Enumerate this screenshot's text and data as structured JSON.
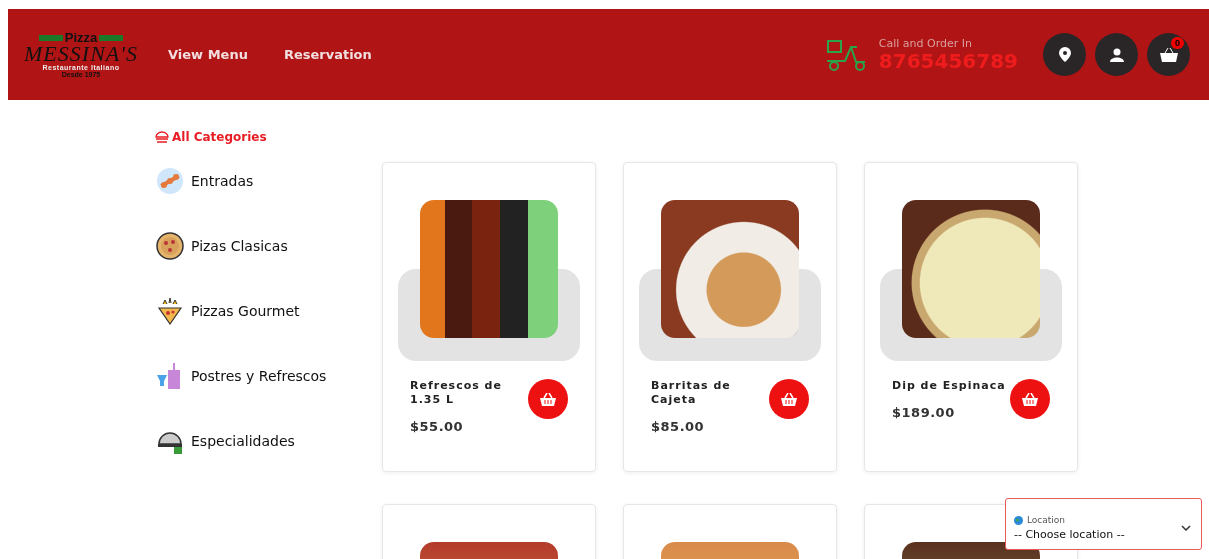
{
  "header": {
    "logo": {
      "top": "Pizza",
      "name": "MESSINA'S",
      "subtitle": "Restaurante Italiano",
      "since": "Desde 1975"
    },
    "nav": [
      {
        "label": "View Menu"
      },
      {
        "label": "Reservation"
      }
    ],
    "call": {
      "label": "Call and Order In",
      "phone": "8765456789"
    },
    "cart_count": "0"
  },
  "sidebar": {
    "title": "All Categories",
    "items": [
      {
        "label": "Entradas",
        "kind": "skewer"
      },
      {
        "label": "Pizas Clasicas",
        "kind": "pizza"
      },
      {
        "label": "Pizzas Gourmet",
        "kind": "slice"
      },
      {
        "label": "Postres y Refrescos",
        "kind": "drink"
      },
      {
        "label": "Especialidades",
        "kind": "cloche"
      }
    ]
  },
  "products": [
    {
      "kind": "full",
      "name": "Refrescos de 1.35 L",
      "price": "$55.00"
    },
    {
      "kind": "full",
      "name": "Barritas de Cajeta",
      "price": "$85.00"
    },
    {
      "kind": "full",
      "name": "Dip de Espinaca",
      "price": "$189.00"
    },
    {
      "kind": "cut_off"
    },
    {
      "kind": "cut_off"
    },
    {
      "kind": "cut_off"
    }
  ],
  "location": {
    "label": "Location",
    "value": "-- Choose location --"
  }
}
